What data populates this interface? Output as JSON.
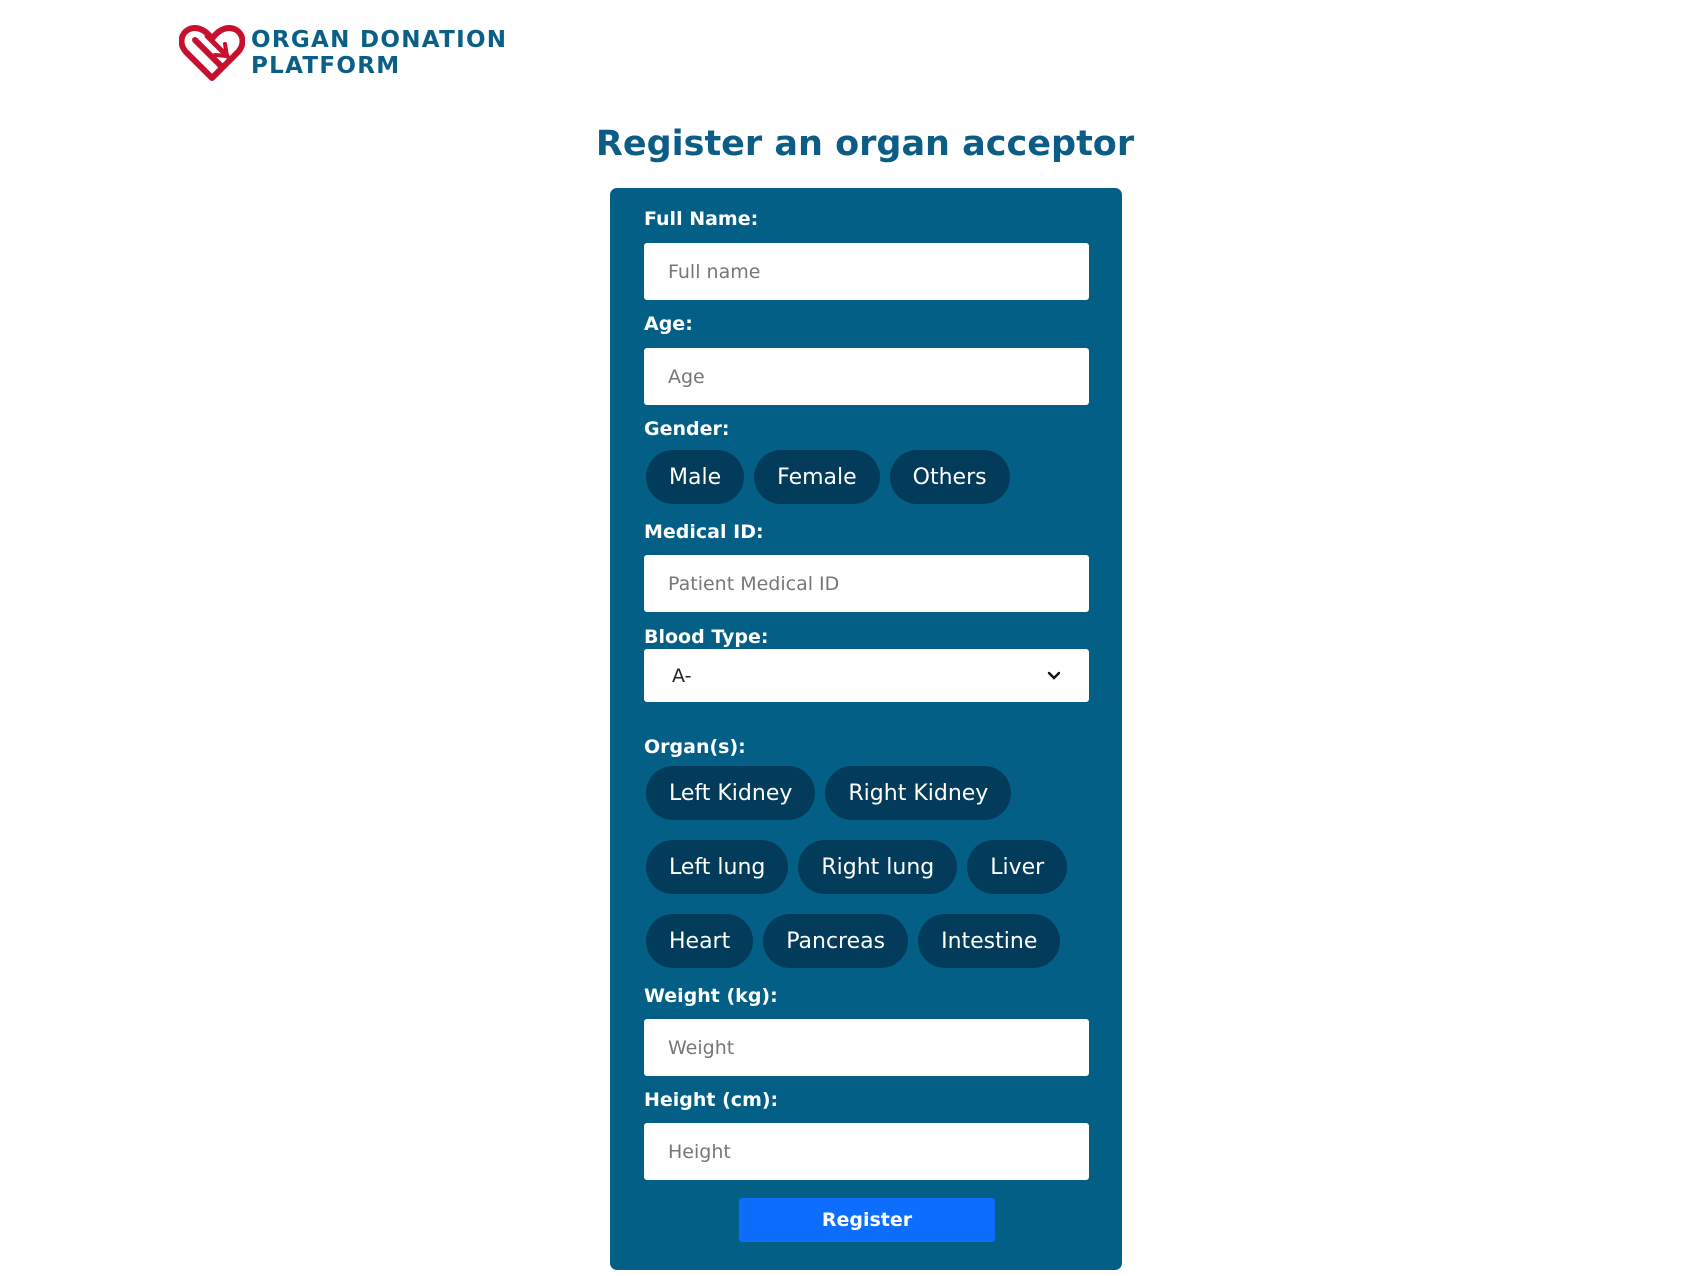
{
  "brand": {
    "line1": "ORGAN DONATION",
    "line2": "PLATFORM",
    "icon": "heart-logo-icon",
    "color": "#0a5f86",
    "icon_color": "#c8102e"
  },
  "title": "Register an organ acceptor",
  "form": {
    "bg_color": "#045f86",
    "full_name": {
      "label": "Full Name:",
      "placeholder": "Full name",
      "value": ""
    },
    "age": {
      "label": "Age:",
      "placeholder": "Age",
      "value": ""
    },
    "gender": {
      "label": "Gender:",
      "options": [
        "Male",
        "Female",
        "Others"
      ]
    },
    "medical_id": {
      "label": "Medical ID:",
      "placeholder": "Patient Medical ID",
      "value": ""
    },
    "blood_type": {
      "label": "Blood Type:",
      "selected": "A-",
      "icon": "chevron-down-icon"
    },
    "organs": {
      "label": "Organ(s):",
      "options": [
        "Left Kidney",
        "Right Kidney",
        "Left lung",
        "Right lung",
        "Liver",
        "Heart",
        "Pancreas",
        "Intestine"
      ]
    },
    "weight": {
      "label": "Weight (kg):",
      "placeholder": "Weight",
      "value": ""
    },
    "height": {
      "label": "Height (cm):",
      "placeholder": "Height",
      "value": ""
    },
    "submit_label": "Register",
    "submit_color": "#0d6efd"
  }
}
